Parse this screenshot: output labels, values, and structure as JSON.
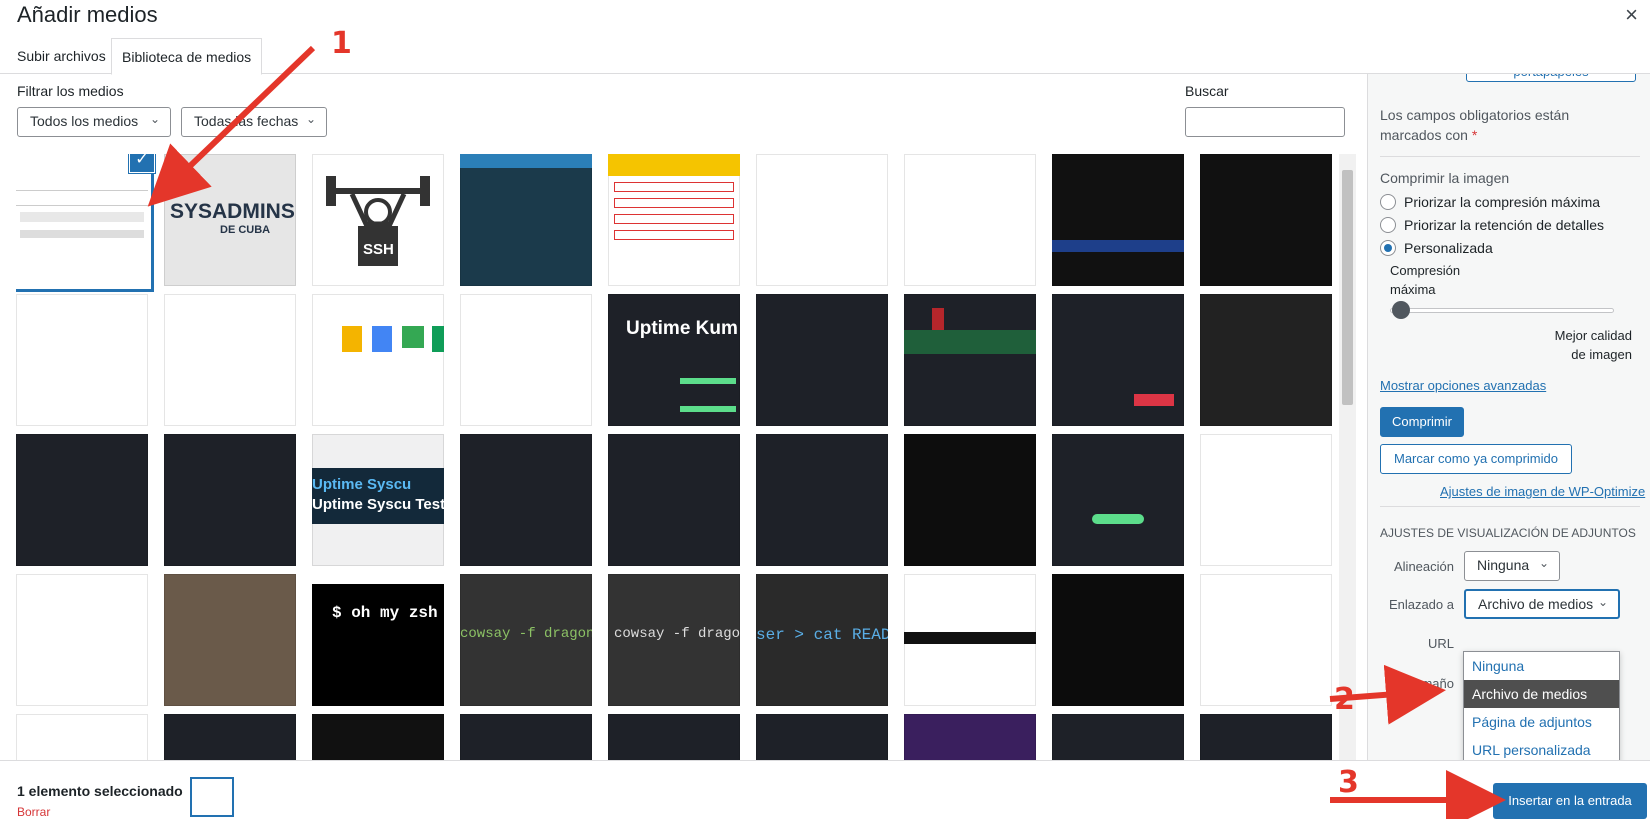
{
  "modal": {
    "title": "Añadir medios",
    "close_glyph": "×"
  },
  "tabs": [
    {
      "label": "Subir archivos"
    },
    {
      "label": "Biblioteca de medios"
    }
  ],
  "filters": {
    "label": "Filtrar los medios",
    "type_value": "Todos los medios",
    "date_value": "Todas las fechas",
    "search_label": "Buscar",
    "search_value": ""
  },
  "thumbnails": {
    "r1c2_text": "SYSADMINS",
    "r1c2_sub": "DE CUBA",
    "r1c3_text": "SSH",
    "r2c5_text": "Uptime Kum",
    "r3c3_line1": "Uptime Syscu",
    "r3c3_line2": "Uptime Syscu Testing",
    "r4c3_text": "$ oh my zsh",
    "r4c5_text": "cowsay -f dragon \"I",
    "r4c6_text": "cowsay -f dragon \"I",
    "r4c7_text": "ser > cat READ"
  },
  "sidebar": {
    "top_button": "portapapeles",
    "required_note": "Los campos obligatorios están marcados con",
    "required_star": "*",
    "compress_heading": "Comprimir la imagen",
    "radio1": "Priorizar la compresión máxima",
    "radio2": "Priorizar la retención de detalles",
    "radio3": "Personalizada",
    "slider_left_label": "Compresión máxima",
    "slider_right_label": "Mejor calidad de imagen",
    "advanced_link": "Mostrar opciones avanzadas",
    "compress_button": "Comprimir",
    "mark_button": "Marcar como ya comprimido",
    "wpo_link": "Ajustes de imagen de WP-Optimize",
    "display_heading": "AJUSTES DE VISUALIZACIÓN DE ADJUNTOS",
    "align_label": "Alineación",
    "align_value": "Ninguna",
    "link_label": "Enlazado a",
    "link_value": "Archivo de medios",
    "url_label": "URL",
    "size_label": "Tamaño"
  },
  "link_dropdown": {
    "options": [
      "Ninguna",
      "Archivo de medios",
      "Página de adjuntos",
      "URL personalizada"
    ],
    "highlighted": 1
  },
  "footer": {
    "selection_count": "1 elemento seleccionado",
    "clear_link": "Borrar",
    "insert_button": "Insertar en la entrada"
  },
  "annotations": {
    "n1": "1",
    "n2": "2",
    "n3": "3",
    "arrow_color": "#e4362a"
  }
}
